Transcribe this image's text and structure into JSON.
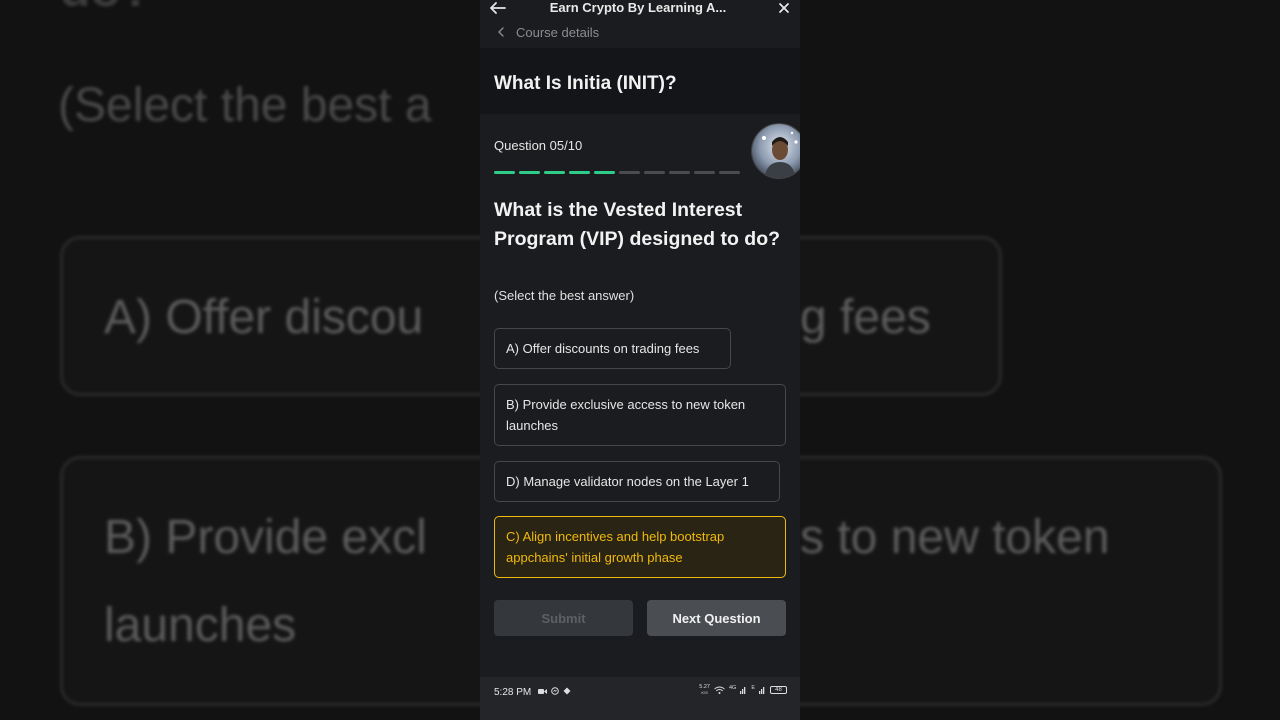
{
  "background": {
    "question_fragment": "do?",
    "hint_fragment": "(Select the best a",
    "option_a_left": "A) Offer discou",
    "option_a_right": "g fees",
    "option_b_left": "B) Provide excl",
    "option_b_right": "s to new token",
    "option_b_line2": "launches"
  },
  "appbar": {
    "title": "Earn Crypto By Learning A...",
    "back_icon": "arrow-left-icon",
    "close_icon": "close-icon"
  },
  "breadcrumb": {
    "label": "Course details"
  },
  "course": {
    "title": "What Is Initia (INIT)?"
  },
  "quiz": {
    "counter": "Question 05/10",
    "current": 5,
    "total": 10,
    "question": "What is the Vested Interest Program (VIP) designed to do?",
    "hint": "(Select the best answer)",
    "options": [
      {
        "label": "A) Offer discounts on trading fees",
        "selected": false
      },
      {
        "label": "B) Provide exclusive access to new token launches",
        "selected": false
      },
      {
        "label": "D) Manage validator nodes on the Layer 1",
        "selected": false
      },
      {
        "label": "C) Align incentives and help bootstrap appchains' initial growth phase",
        "selected": true
      }
    ],
    "submit_label": "Submit",
    "next_label": "Next Question"
  },
  "status_bar": {
    "time": "5:28 PM",
    "net_speed": "5.27",
    "net_unit": "K/S",
    "network": "4G",
    "network2": "E",
    "battery": "48"
  },
  "colors": {
    "accent_green": "#2fcc89",
    "selected_gold": "#f0b90b",
    "phone_bg": "#1b1c1f"
  }
}
